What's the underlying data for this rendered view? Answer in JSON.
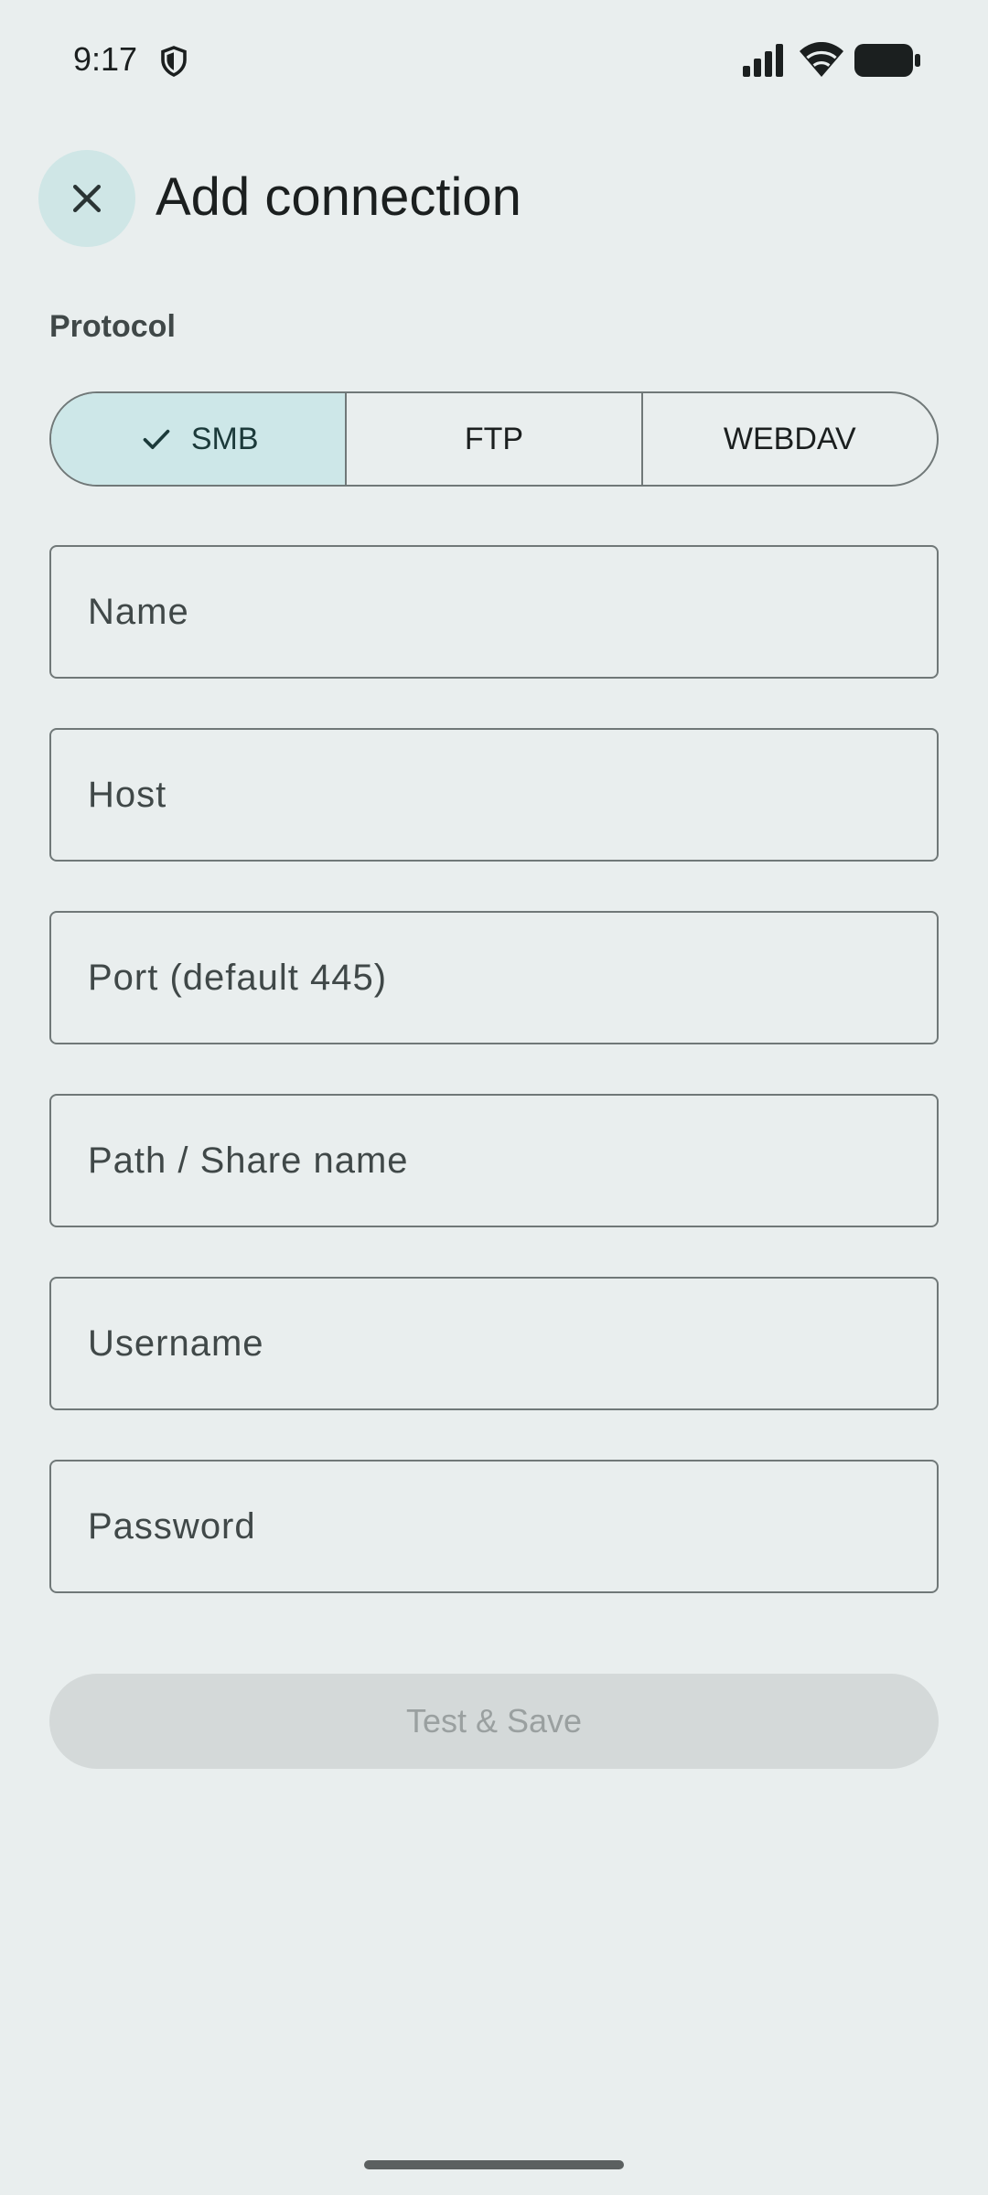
{
  "status_bar": {
    "time": "9:17",
    "icons": [
      "shield-icon",
      "signal-icon",
      "wifi-icon",
      "battery-icon"
    ]
  },
  "header": {
    "close_icon": "close-icon",
    "title": "Add connection"
  },
  "protocol": {
    "label": "Protocol",
    "options": [
      {
        "label": "SMB",
        "selected": true
      },
      {
        "label": "FTP",
        "selected": false
      },
      {
        "label": "WEBDAV",
        "selected": false
      }
    ]
  },
  "form": {
    "name_placeholder": "Name",
    "host_placeholder": "Host",
    "port_placeholder": "Port (default 445)",
    "path_placeholder": "Path / Share name",
    "username_placeholder": "Username",
    "password_placeholder": "Password",
    "name_value": "",
    "host_value": "",
    "port_value": "",
    "path_value": "",
    "username_value": "",
    "password_value": ""
  },
  "actions": {
    "save_label": "Test & Save"
  },
  "colors": {
    "background": "#e9eeee",
    "accent_container": "#cde7e8",
    "outline": "#707878",
    "disabled_button": "#d4d9d9",
    "disabled_text": "#9aa0a0"
  }
}
